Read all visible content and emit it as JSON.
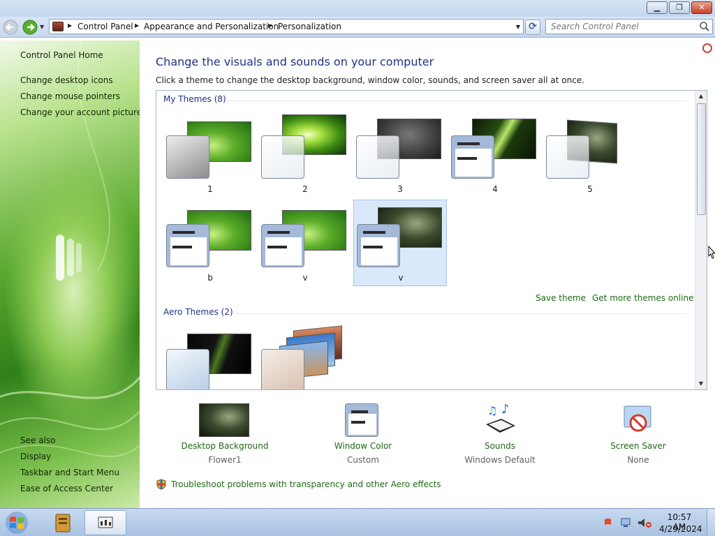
{
  "window": {
    "minimize_glyph": "▁",
    "maximize_glyph": "❐",
    "close_glyph": "✕"
  },
  "address_bar": {
    "crumbs": [
      "Control Panel",
      "Appearance and Personalization",
      "Personalization"
    ]
  },
  "search": {
    "placeholder": "Search Control Panel"
  },
  "sidebar": {
    "home": "Control Panel Home",
    "tasks": [
      "Change desktop icons",
      "Change mouse pointers",
      "Change your account picture"
    ],
    "see_also_title": "See also",
    "see_also": [
      "Display",
      "Taskbar and Start Menu",
      "Ease of Access Center"
    ]
  },
  "main": {
    "title": "Change the visuals and sounds on your computer",
    "subtitle": "Click a theme to change the desktop background, window color, sounds, and screen saver all at once.",
    "my_themes_header": "My Themes (8)",
    "my_themes": [
      {
        "name": "1",
        "background": "green-swirl",
        "selected": false
      },
      {
        "name": "2",
        "background": "green-burst",
        "selected": false
      },
      {
        "name": "3",
        "background": "dark-grey",
        "selected": false
      },
      {
        "name": "4",
        "background": "green-ribbon",
        "selected": false
      },
      {
        "name": "5",
        "background": "dark-flower",
        "selected": false
      },
      {
        "name": "b",
        "background": "green-swirl",
        "selected": false
      },
      {
        "name": "v",
        "background": "green-swirl",
        "selected": false
      },
      {
        "name": "v",
        "background": "dark-flower",
        "selected": true
      }
    ],
    "save_theme": "Save theme",
    "get_more": "Get more themes online",
    "aero_header": "Aero Themes (2)"
  },
  "settings": [
    {
      "label": "Desktop Background",
      "value": "Flower1"
    },
    {
      "label": "Window Color",
      "value": "Custom"
    },
    {
      "label": "Sounds",
      "value": "Windows Default"
    },
    {
      "label": "Screen Saver",
      "value": "None"
    }
  ],
  "troubleshoot": "Troubleshoot problems with transparency and other Aero effects",
  "taskbar": {
    "time": "10:57 AM",
    "date": "4/29/2024"
  },
  "colors": {
    "link_green": "#1d6a12",
    "heading_blue": "#1e3287",
    "selection": "#d9e9fb"
  }
}
